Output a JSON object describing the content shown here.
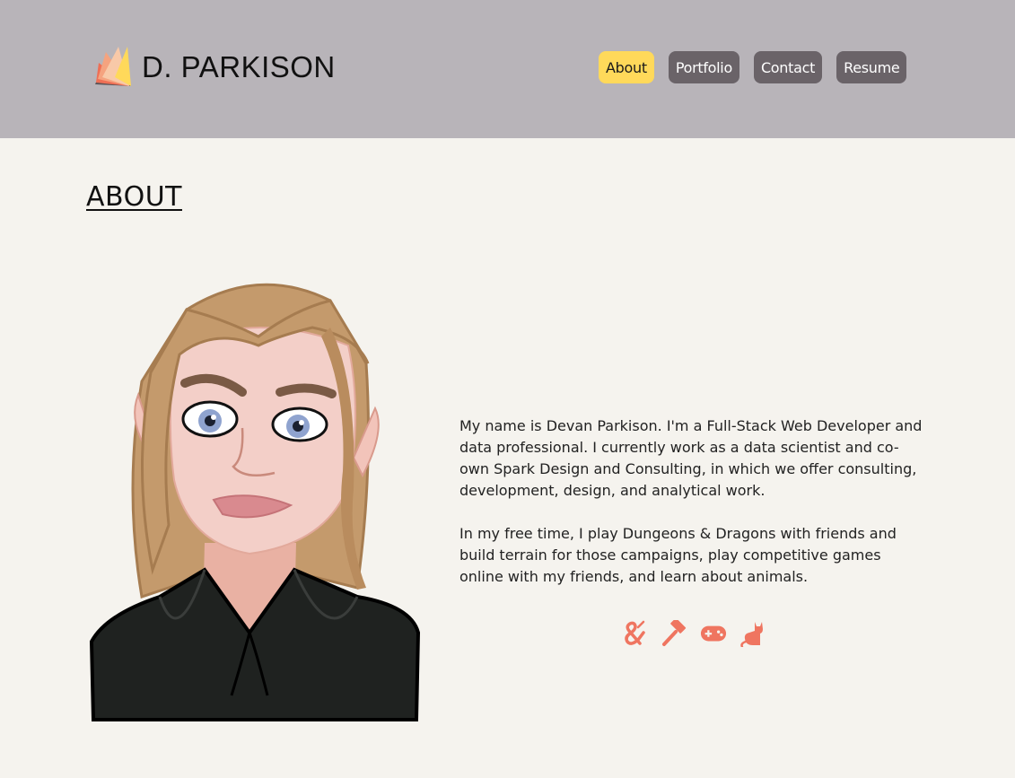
{
  "header": {
    "brand_name": "D. PARKISON",
    "nav": [
      {
        "label": "About",
        "active": true
      },
      {
        "label": "Portfolio",
        "active": false
      },
      {
        "label": "Contact",
        "active": false
      },
      {
        "label": "Resume",
        "active": false
      }
    ]
  },
  "main": {
    "title": "ABOUT",
    "bio_paragraphs": [
      "My name is Devan Parkison. I'm a Full-Stack Web Developer and data professional. I currently work as a data scientist and co-own Spark Design and Consulting, in which we offer consulting, development, design, and analytical work.",
      "In my free time, I play Dungeons & Dragons with friends and build terrain for those campaigns, play competitive games online with my friends, and learn about animals."
    ],
    "hobby_icons": [
      "dnd-ampersand-icon",
      "hammer-icon",
      "gamepad-icon",
      "cat-icon"
    ]
  },
  "colors": {
    "header_bg": "#b8b4b9",
    "page_bg": "#f5f3ee",
    "nav_active": "#ffd95a",
    "nav_default": "#6a6368",
    "icon_accent": "#ef7560"
  }
}
